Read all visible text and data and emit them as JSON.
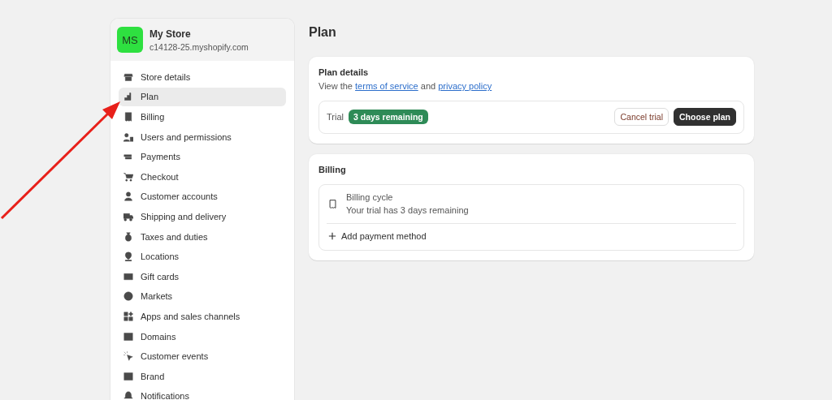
{
  "store": {
    "initials": "MS",
    "name": "My Store",
    "domain": "c14128-25.myshopify.com"
  },
  "sidebar": {
    "items": [
      {
        "label": "Store details",
        "selected": false
      },
      {
        "label": "Plan",
        "selected": true
      },
      {
        "label": "Billing",
        "selected": false
      },
      {
        "label": "Users and permissions",
        "selected": false
      },
      {
        "label": "Payments",
        "selected": false
      },
      {
        "label": "Checkout",
        "selected": false
      },
      {
        "label": "Customer accounts",
        "selected": false
      },
      {
        "label": "Shipping and delivery",
        "selected": false
      },
      {
        "label": "Taxes and duties",
        "selected": false
      },
      {
        "label": "Locations",
        "selected": false
      },
      {
        "label": "Gift cards",
        "selected": false
      },
      {
        "label": "Markets",
        "selected": false
      },
      {
        "label": "Apps and sales channels",
        "selected": false
      },
      {
        "label": "Domains",
        "selected": false
      },
      {
        "label": "Customer events",
        "selected": false
      },
      {
        "label": "Brand",
        "selected": false
      },
      {
        "label": "Notifications",
        "selected": false
      }
    ]
  },
  "page_title": "Plan",
  "plan_details": {
    "title": "Plan details",
    "text_before": "View the",
    "link_1": "terms of service",
    "text_between": "and",
    "link_2": "privacy policy",
    "trial_label": "Trial",
    "badge": "3 days remaining",
    "buttons": [
      "Cancel trial",
      "Choose plan"
    ]
  },
  "billing": {
    "title": "Billing",
    "cycle_title": "Billing cycle",
    "cycle_text": "Your trial has 3 days remaining",
    "add_action": "Add payment method"
  }
}
